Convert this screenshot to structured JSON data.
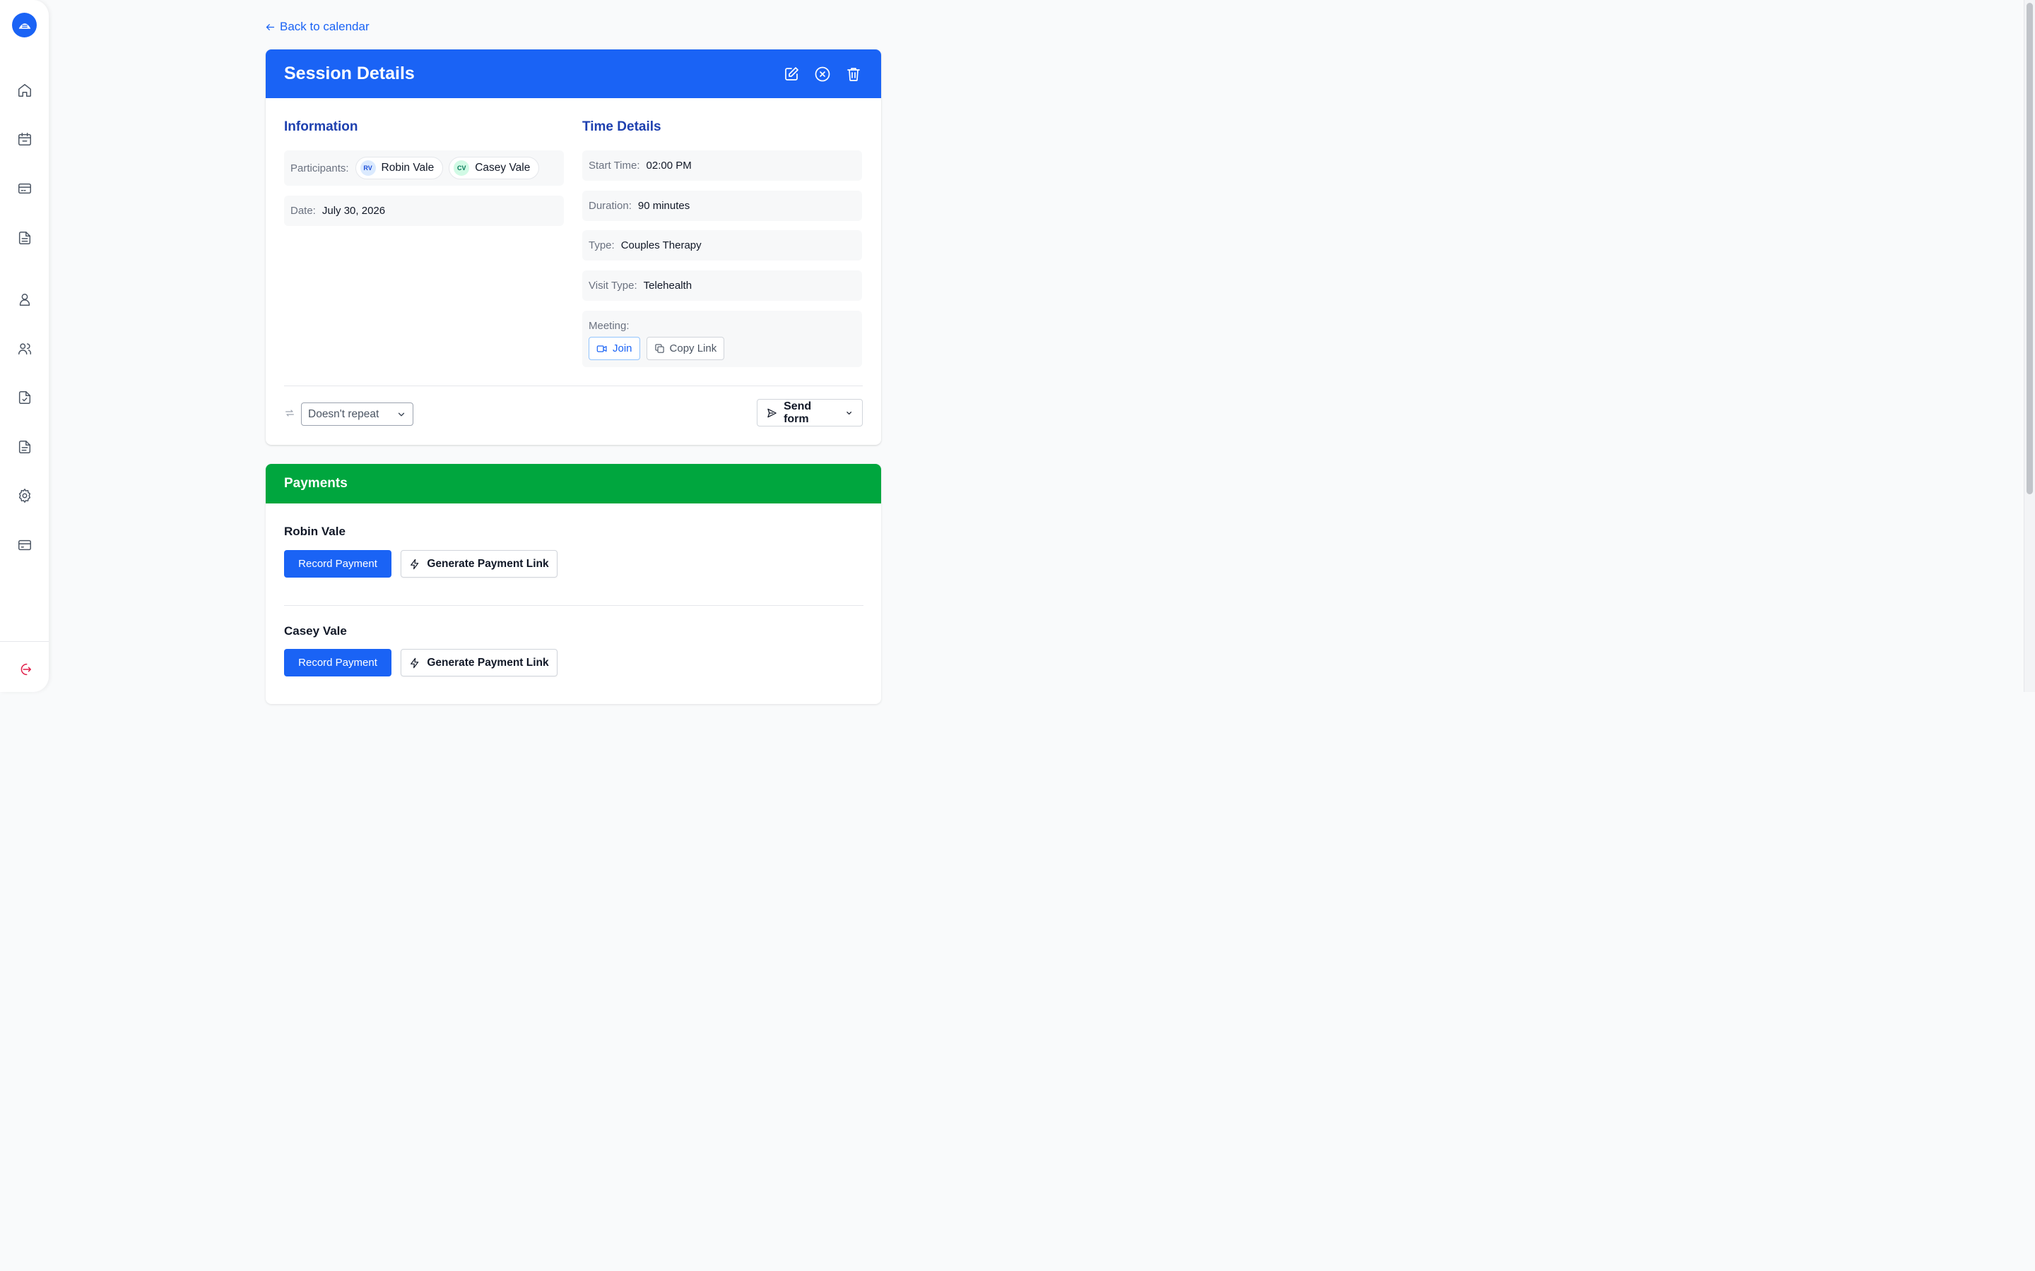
{
  "nav": {
    "back_label": "Back to calendar",
    "icons": [
      "home-icon",
      "calendar-icon",
      "card-icon",
      "document-icon",
      "user-icon",
      "users-icon",
      "file-check-icon",
      "file-text-icon",
      "gear-icon",
      "billing-icon",
      "logout-icon"
    ]
  },
  "session": {
    "title": "Session Details",
    "information_title": "Information",
    "time_title": "Time Details",
    "participants_label": "Participants:",
    "participants": [
      {
        "initials": "RV",
        "name": "Robin Vale",
        "color": "#1d4ed8",
        "bg": "#dbeafe"
      },
      {
        "initials": "CV",
        "name": "Casey Vale",
        "color": "#047857",
        "bg": "#d1fae5"
      }
    ],
    "date_label": "Date:",
    "date_value": "July 30, 2026",
    "start_label": "Start Time:",
    "start_value": "02:00 PM",
    "duration_label": "Duration:",
    "duration_value": "90 minutes",
    "type_label": "Type:",
    "type_value": "Couples Therapy",
    "visit_label": "Visit Type:",
    "visit_value": "Telehealth",
    "meeting_label": "Meeting:",
    "join_label": "Join",
    "copy_label": "Copy Link",
    "repeat_value": "Doesn't repeat",
    "send_form_label": "Send form"
  },
  "payments": {
    "title": "Payments",
    "clients": [
      {
        "name": "Robin Vale",
        "record_label": "Record Payment",
        "link_label": "Generate Payment Link"
      },
      {
        "name": "Casey Vale",
        "record_label": "Record Payment",
        "link_label": "Generate Payment Link"
      }
    ]
  },
  "colors": {
    "primary": "#1a63f5",
    "success": "#00a63e",
    "heading": "#1e40af",
    "logout": "#e11d48"
  }
}
